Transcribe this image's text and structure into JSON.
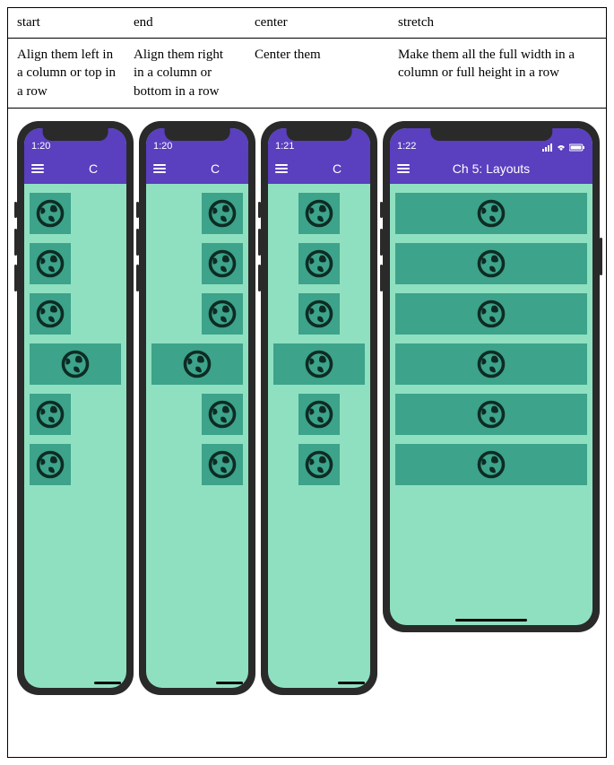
{
  "headers": {
    "c0": "start",
    "c1": "end",
    "c2": "center",
    "c3": "stretch"
  },
  "descriptions": {
    "c0": "Align them left in a column or top in a row",
    "c1": "Align them right in a column or bottom in a row",
    "c2": "Center them",
    "c3": "Make them all the full width in a column or full height in a row"
  },
  "phones": {
    "p0": {
      "time": "1:20",
      "title": "C"
    },
    "p1": {
      "time": "1:20",
      "title": "C"
    },
    "p2": {
      "time": "1:21",
      "title": "C"
    },
    "p3": {
      "time": "1:22",
      "title": "Ch 5: Layouts"
    }
  },
  "status_icons": {
    "signal": "signal-icon",
    "wifi": "wifi-icon",
    "battery": "battery-icon"
  },
  "globe_icon_name": "globe-icon",
  "tile_count": 6
}
